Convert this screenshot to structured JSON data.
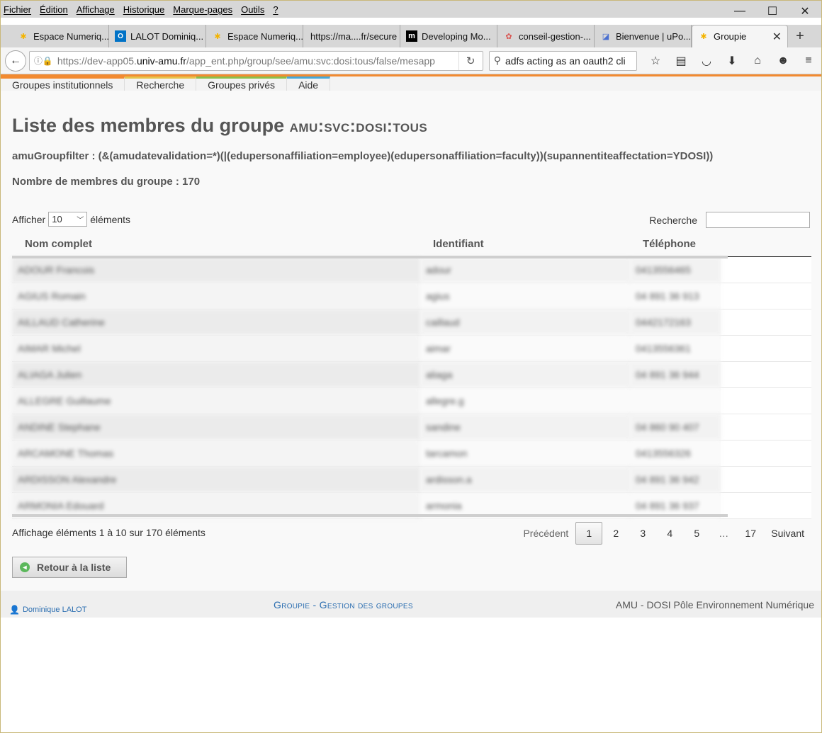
{
  "menubar": {
    "items": [
      "Fichier",
      "Édition",
      "Affichage",
      "Historique",
      "Marque-pages",
      "Outils",
      "?"
    ]
  },
  "window_controls": {
    "minimize": "—",
    "maximize": "☐",
    "close": "✕"
  },
  "tabs": [
    {
      "label": "Espace Numeriq...",
      "icon": "amu-star-icon",
      "color": "#f4b400"
    },
    {
      "label": "LALOT Dominiq...",
      "icon": "outlook-icon",
      "color": "#0072c6"
    },
    {
      "label": "Espace Numeriq...",
      "icon": "amu-star-icon",
      "color": "#f4b400"
    },
    {
      "label": "https://ma....fr/secure",
      "icon": "blank-page-icon",
      "color": "#999999"
    },
    {
      "label": "Developing Mo...",
      "icon": "m-logo-icon",
      "color": "#000000"
    },
    {
      "label": "conseil-gestion-...",
      "icon": "flower-icon",
      "color": "#d9534f"
    },
    {
      "label": "Bienvenue | uPo...",
      "icon": "uportal-icon",
      "color": "#4a6fd0"
    },
    {
      "label": "Groupie",
      "icon": "amu-star-icon",
      "color": "#f4b400",
      "active": true
    }
  ],
  "newtab_label": "+",
  "navbar": {
    "url_prefix": "https://dev-app05.",
    "url_domain": "univ-amu.fr",
    "url_suffix": "/app_ent.php/group/see/amu:svc:dosi:tous/false/mesapp",
    "search_text": "adfs acting as an oauth2 cli",
    "toolbar_icons": [
      "star-icon",
      "reading-list-icon",
      "pocket-icon",
      "download-icon",
      "home-icon",
      "smiley-icon",
      "menu-icon"
    ]
  },
  "appnav": {
    "items": [
      "Groupes institutionnels",
      "Recherche",
      "Groupes privés",
      "Aide"
    ]
  },
  "page": {
    "title": "Liste des membres du groupe",
    "group_name": "amu:svc:dosi:tous",
    "filter": "amuGroupfilter : (&(amudatevalidation=*)(|(edupersonaffiliation=employee)(edupersonaffiliation=faculty))(supannentiteaffectation=YDOSI))",
    "count_label": "Nombre de membres du groupe : 170",
    "length_prefix": "Afficher",
    "length_value": "10",
    "length_suffix": "éléments",
    "search_label": "Recherche"
  },
  "table": {
    "columns": [
      "Nom complet",
      "Identifiant",
      "Téléphone"
    ],
    "rows": [
      [
        "ADOUR Francois",
        "adour",
        "0413556465"
      ],
      [
        "AGIUS Romain",
        "agius",
        "04 891 36 913"
      ],
      [
        "AILLAUD Catherine",
        "caillaud",
        "0442172163"
      ],
      [
        "AIMAR Michel",
        "aimar",
        "0413556361"
      ],
      [
        "ALIAGA Julien",
        "aliaga",
        "04 891 36 944"
      ],
      [
        "ALLEGRE Guillaume",
        "allegre.g",
        ""
      ],
      [
        "ANDINE Stephane",
        "sandine",
        "04 860 90 407"
      ],
      [
        "ARCAMONE Thomas",
        "tarcamon",
        "0413556326"
      ],
      [
        "ARDISSON Alexandre",
        "ardisson.a",
        "04 891 36 942"
      ],
      [
        "ARMONIA Edouard",
        "armonia",
        "04 891 36 937"
      ]
    ]
  },
  "pagination": {
    "info": "Affichage éléments 1 à 10 sur 170 éléments",
    "previous": "Précédent",
    "pages": [
      "1",
      "2",
      "3",
      "4",
      "5",
      "…",
      "17"
    ],
    "next": "Suivant"
  },
  "back_button": "Retour à la liste",
  "footer": {
    "user": "Dominique LALOT",
    "app": "Groupie - Gestion des groupes",
    "org": "AMU - DOSI Pôle Environnement Numérique"
  }
}
